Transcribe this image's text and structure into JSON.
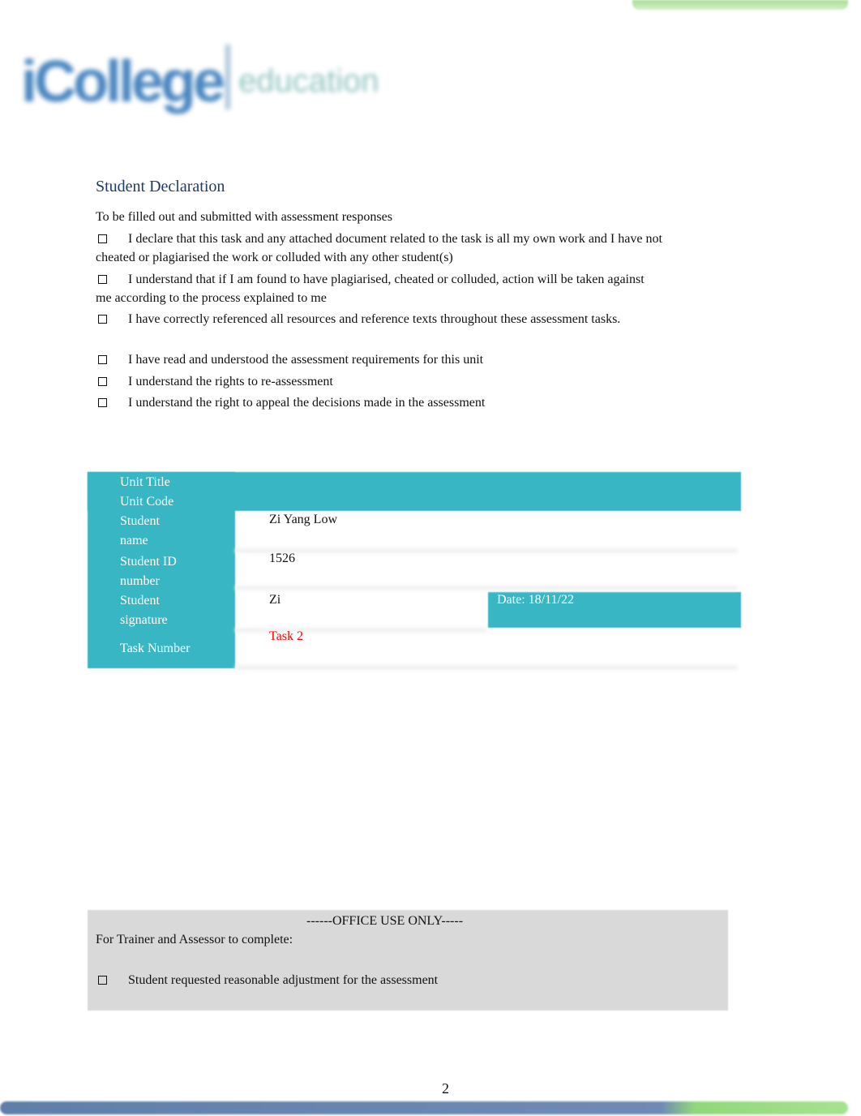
{
  "logo": {
    "text": "iCollege",
    "subtext": "education"
  },
  "declaration": {
    "title": "Student Declaration",
    "intro": "To be filled out and submitted with assessment responses",
    "items": [
      "I declare that this task and any attached document related to the task is all my own work and I have not cheated or plagiarised the work or colluded with any other student(s)",
      "I understand that if I am found to have plagiarised, cheated or colluded, action will be taken against me according to the process explained to me",
      "I have correctly referenced all resources and reference texts throughout these assessment tasks.",
      "I have read and understood the assessment requirements for this unit",
      "I understand the rights to re-assessment",
      "I understand the right to appeal the decisions made in the assessment"
    ]
  },
  "table": {
    "unit_title_label": "Unit Title",
    "unit_code_label": "Unit Code",
    "student_name_label": "Student name",
    "student_name": "Zi Yang Low",
    "student_id_label": "Student ID number",
    "student_id": "1526",
    "signature_label": "Student signature",
    "signature": "Zi",
    "date": "Date: 18/11/22",
    "task_number_label": "Task Number",
    "task_number": "Task 2",
    "task_color": "#ff0000",
    "accent_color": "#38b6c4"
  },
  "office": {
    "title": "------OFFICE USE ONLY-----",
    "subtitle": "For Trainer and Assessor to complete:",
    "item": "Student requested reasonable adjustment for the assessment"
  },
  "page_number": "2"
}
